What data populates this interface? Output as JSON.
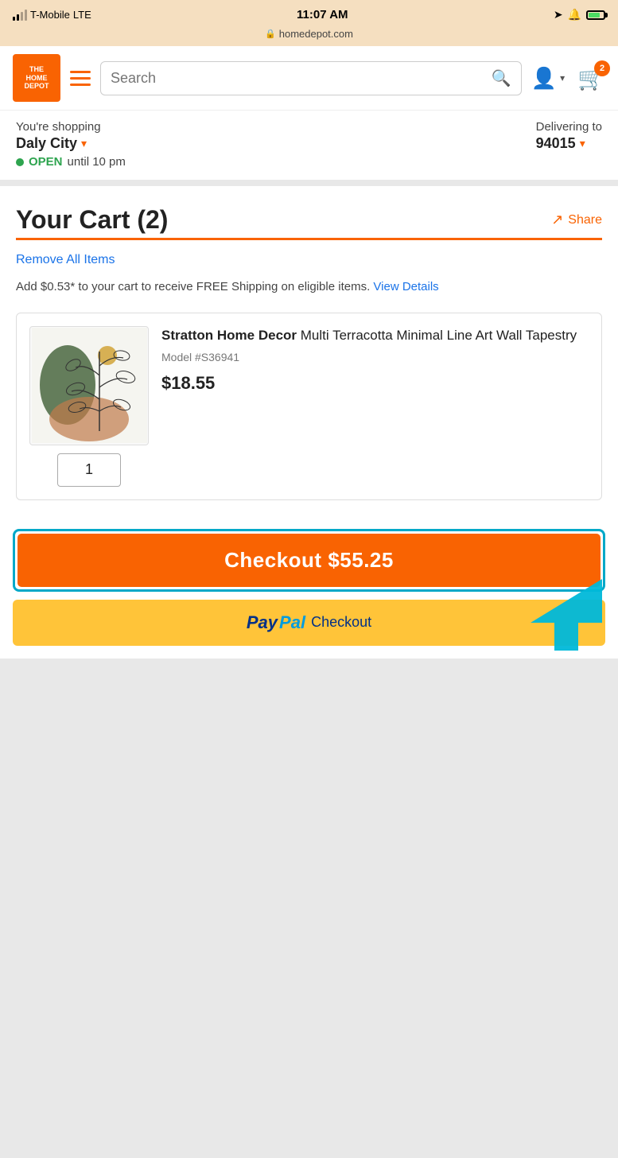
{
  "statusBar": {
    "carrier": "T-Mobile",
    "network": "LTE",
    "time": "11:07 AM",
    "url": "homedepot.com"
  },
  "header": {
    "logoLine1": "THE",
    "logoLine2": "HOME",
    "logoLine3": "DEPOT",
    "searchPlaceholder": "Search",
    "cartCount": "2"
  },
  "location": {
    "shoppingLabel": "You're shopping",
    "city": "Daly City",
    "openText": "OPEN",
    "openHours": "until 10 pm",
    "deliverLabel": "Delivering to",
    "zipCode": "94015"
  },
  "cart": {
    "title": "Your Cart (2)",
    "shareLabel": "Share",
    "removeAllLabel": "Remove All Items",
    "freeShippingMsg": "Add $0.53* to your cart to receive FREE Shipping on eligible items.",
    "viewDetailsLabel": "View Details"
  },
  "product": {
    "name": "Stratton Home Decor",
    "nameSuffix": " Multi Terracotta Minimal Line Art Wall Tapestry",
    "modelNumber": "Model #S36941",
    "price": "$18.55",
    "quantity": "1"
  },
  "checkout": {
    "buttonLabel": "Checkout",
    "totalAmount": "$55.25",
    "paypalLabel": "Checkout"
  }
}
